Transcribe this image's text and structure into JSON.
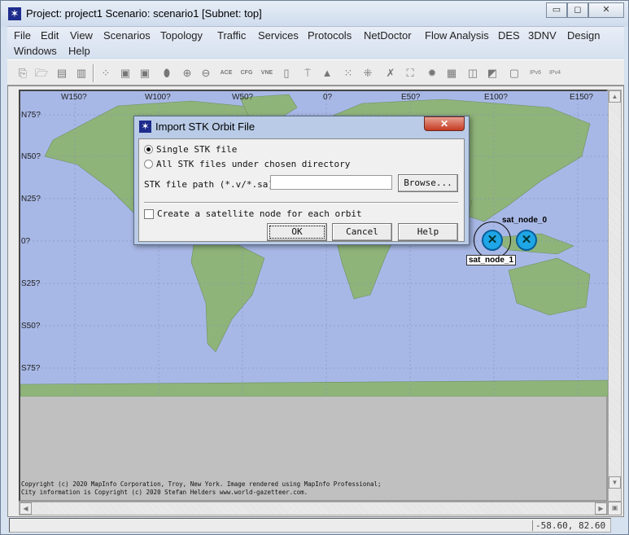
{
  "window": {
    "title": "Project: project1 Scenario: scenario1  [Subnet: top]",
    "minimize": "▭",
    "maximize": "◻",
    "close": "✕"
  },
  "menu": [
    "File",
    "Edit",
    "View",
    "Scenarios",
    "Topology",
    "Traffic",
    "Services",
    "Protocols",
    "NetDoctor",
    "Flow Analysis",
    "DES",
    "3DNV",
    "Design",
    "Windows",
    "Help"
  ],
  "toolbar": {
    "icons": [
      "new-project",
      "open",
      "save",
      "print",
      "node-palette",
      "rapid-config",
      "deploy-wizard",
      "locate",
      "zoom-in",
      "zoom-out",
      "ace",
      "cfg",
      "vne",
      "device",
      "import",
      "triangle",
      "topology-select",
      "topology-fail",
      "link-check",
      "path",
      "traffic",
      "report",
      "graph",
      "chart",
      "doc",
      "ipv6",
      "ipv4-ipv6"
    ],
    "labels": {
      "ace": "ACE",
      "cfg": "CFG",
      "vne": "VNE",
      "ipv4": "IPv4",
      "ipv6": "IPv6"
    }
  },
  "map": {
    "lon_labels": [
      "W150?",
      "W100?",
      "W50?",
      "0?",
      "E50?",
      "E100?",
      "E150?"
    ],
    "lat_labels": [
      "N75?",
      "N50?",
      "N25?",
      "0?",
      "S25?",
      "S50?",
      "S75?"
    ],
    "colors": {
      "ocean": "#a8b8e6",
      "land": "#8fb47a"
    },
    "nodes": [
      {
        "label": "sat_node_0"
      },
      {
        "label": "sat_node_1"
      }
    ],
    "copyright": [
      "Copyright (c) 2020 MapInfo Corporation, Troy, New York. Image rendered using MapInfo Professional;",
      "City information is Copyright (c) 2020 Stefan Helders www.world-gazetteer.com."
    ]
  },
  "status": {
    "coords": "-58.60, 82.60"
  },
  "dialog": {
    "title": "Import STK Orbit File",
    "close": "✕",
    "options": [
      {
        "label": "Single STK file",
        "selected": true
      },
      {
        "label": "All STK files under chosen directory",
        "selected": false
      }
    ],
    "path_label": "STK file path (*.v/*.sa):",
    "path_value": "",
    "browse": "Browse...",
    "checkbox_label": "Create a satellite node for each orbit",
    "checkbox_checked": false,
    "ok": "OK",
    "cancel": "Cancel",
    "help": "Help"
  }
}
